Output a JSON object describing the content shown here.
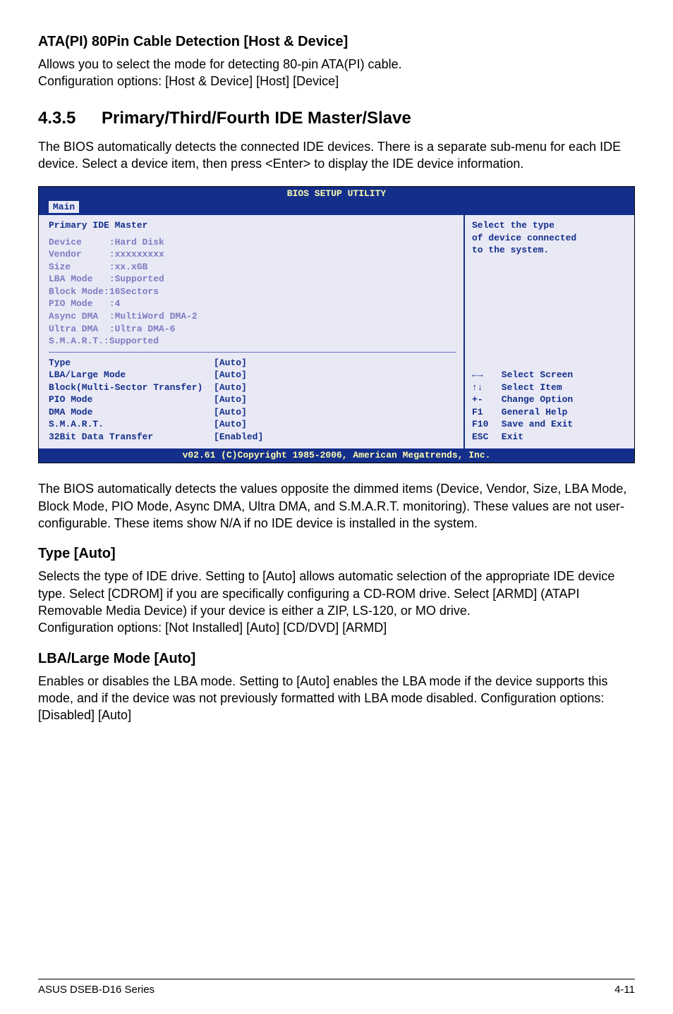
{
  "sectionA": {
    "heading": "ATA(PI) 80Pin Cable Detection [Host & Device]",
    "body1": "Allows you to select the mode for detecting 80-pin ATA(PI) cable.",
    "body2": "Configuration options: [Host & Device] [Host] [Device]"
  },
  "section435": {
    "num": "4.3.5",
    "title": "Primary/Third/Fourth IDE Master/Slave",
    "body": "The BIOS automatically detects the connected IDE devices. There is a separate sub-menu for each IDE device. Select a device item, then press <Enter> to display the IDE device information."
  },
  "bios": {
    "header": "BIOS SETUP UTILITY",
    "tab": "Main",
    "left": {
      "title": "Primary IDE Master",
      "info": [
        "Device     :Hard Disk",
        "Vendor     :xxxxxxxxx",
        "Size       :xx.xGB",
        "LBA Mode   :Supported",
        "Block Mode:16Sectors",
        "PIO Mode   :4",
        "Async DMA  :MultiWord DMA-2",
        "Ultra DMA  :Ultra DMA-6",
        "S.M.A.R.T.:Supported"
      ],
      "options": [
        {
          "k": "Type",
          "v": "[Auto]"
        },
        {
          "k": "LBA/Large Mode",
          "v": "[Auto]"
        },
        {
          "k": "Block(Multi-Sector Transfer)",
          "v": "[Auto]"
        },
        {
          "k": "PIO Mode",
          "v": "[Auto]"
        },
        {
          "k": "DMA Mode",
          "v": "[Auto]"
        },
        {
          "k": "S.M.A.R.T.",
          "v": "[Auto]"
        },
        {
          "k": "32Bit Data Transfer",
          "v": "[Enabled]"
        }
      ]
    },
    "right": {
      "help1": "Select the type",
      "help2": "of device connected",
      "help3": "to the system.",
      "nav": [
        {
          "key": "←→",
          "txt": "Select Screen"
        },
        {
          "key": "↑↓",
          "txt": "Select Item"
        },
        {
          "key": "+-",
          "txt": "Change Option"
        },
        {
          "key": "F1",
          "txt": "General Help"
        },
        {
          "key": "F10",
          "txt": "Save and Exit"
        },
        {
          "key": "ESC",
          "txt": "Exit"
        }
      ]
    },
    "footer": "v02.61 (C)Copyright 1985-2006, American Megatrends, Inc."
  },
  "afterBios": "The BIOS automatically detects the values opposite the dimmed items (Device, Vendor, Size, LBA Mode, Block Mode, PIO Mode, Async DMA, Ultra DMA, and S.M.A.R.T. monitoring). These values are not user-configurable. These items show N/A if no IDE device is installed in the system.",
  "typeAuto": {
    "heading": "Type [Auto]",
    "body1": "Selects the type of IDE drive. Setting to [Auto] allows automatic selection of the appropriate IDE device type. Select [CDROM] if you are specifically configuring a CD-ROM drive. Select [ARMD] (ATAPI Removable Media Device) if your device is either a ZIP, LS-120, or MO drive.",
    "body2": "Configuration options: [Not Installed] [Auto] [CD/DVD] [ARMD]"
  },
  "lba": {
    "heading": "LBA/Large Mode [Auto]",
    "body": "Enables or disables the LBA mode. Setting to [Auto] enables the LBA mode if the device supports this mode, and if the device was not previously formatted with LBA mode disabled. Configuration options: [Disabled] [Auto]"
  },
  "footer": {
    "left": "ASUS DSEB-D16 Series",
    "right": "4-11"
  }
}
